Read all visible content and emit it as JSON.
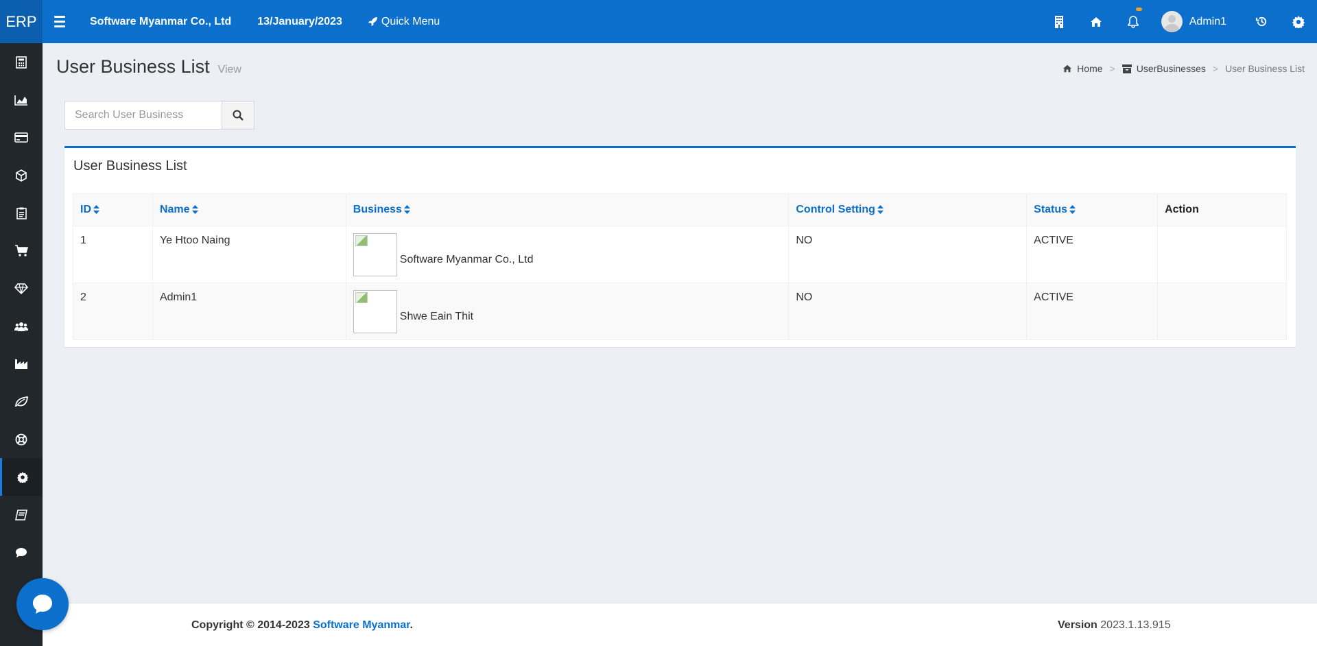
{
  "app": {
    "logo": "ERP"
  },
  "topbar": {
    "company": "Software Myanmar Co., Ltd",
    "date": "13/January/2023",
    "quick_menu": "Quick Menu",
    "user_name": "Admin1",
    "icons": [
      "building-icon",
      "home-icon",
      "bell-icon",
      "history-icon",
      "gear-icon"
    ]
  },
  "sidebar": {
    "items": [
      "calculator-icon",
      "area-chart-icon",
      "credit-card-icon",
      "cube-icon",
      "clipboard-icon",
      "cart-icon",
      "diamond-icon",
      "users-icon",
      "industry-icon",
      "leaf-icon",
      "life-ring-icon",
      "settings-icon",
      "book-icon",
      "comment-icon"
    ],
    "active_item": "settings-icon"
  },
  "page": {
    "title": "User Business List",
    "subtitle": "View"
  },
  "breadcrumb": {
    "home": "Home",
    "section": "UserBusinesses",
    "current": "User Business List",
    "separator": ">"
  },
  "search": {
    "placeholder": "Search User Business"
  },
  "box": {
    "title": "User Business List",
    "columns": [
      "ID",
      "Name",
      "Business",
      "Control Setting",
      "Status",
      "Action"
    ],
    "rows": [
      {
        "id": "1",
        "name": "Ye Htoo Naing",
        "business": "Software Myanmar Co., Ltd",
        "control_setting": "NO",
        "status": "ACTIVE",
        "action": ""
      },
      {
        "id": "2",
        "name": "Admin1",
        "business": "Shwe Eain Thit",
        "control_setting": "NO",
        "status": "ACTIVE",
        "action": ""
      }
    ]
  },
  "footer": {
    "copyright_prefix": "Copyright © 2014-2023",
    "company_link": "Software Myanmar",
    "copyright_suffix": ".",
    "version_label": "Version",
    "version": "2023.1.13.915"
  },
  "colors": {
    "primary": "#0b6fcb",
    "sidebar": "#22272c",
    "background": "#eceff3"
  }
}
